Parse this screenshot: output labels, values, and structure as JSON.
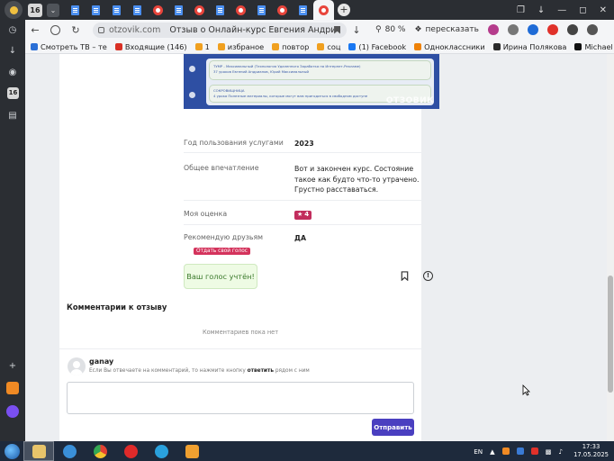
{
  "browser": {
    "tab_counter": "16",
    "tab_counter_side": "16",
    "address": {
      "domain": "otzovik.com",
      "title": "Отзыв о Онлайн-курс Евгения Андри..."
    },
    "zoom": "80 %",
    "speak_label": "пересказать"
  },
  "bookmarks": [
    {
      "label": "Смотреть ТВ – те",
      "color": "#2a6fd6"
    },
    {
      "label": "Входящие (146)",
      "color": "#d93025"
    },
    {
      "label": "1",
      "color": "#f0a020"
    },
    {
      "label": "избраное",
      "color": "#f0a020"
    },
    {
      "label": "повтор",
      "color": "#f0a020"
    },
    {
      "label": "соц",
      "color": "#f0a020"
    },
    {
      "label": "(1) Facebook",
      "color": "#1877f2"
    },
    {
      "label": "Одноклассники",
      "color": "#ee8208"
    },
    {
      "label": "Ирина Полякова",
      "color": "#2a2a2a"
    },
    {
      "label": "Michael Hudso",
      "color": "#111111"
    }
  ],
  "banner": {
    "row1_title": "ТУМР - Максимальный (Технология Удаленного Заработка на Интернет-Рекламе)",
    "row1_sub": "37 уроков  Евгений Андрианов, Юрий Максимальный",
    "row2_title": "СОКРОВИЩНИЦА",
    "row2_sub": "4 урока  Полезные материалы, которые могут вам пригодиться в свободном доступе",
    "watermark": "ОТЗОВИК"
  },
  "review": {
    "year_label": "Год пользования услугами",
    "year_value": "2023",
    "impression_label": "Общее впечатление",
    "impression_value": "Вот и закончен курс. Состояние такое как будто что-то утрачено. Грустно расставаться.",
    "rating_label": "Моя оценка",
    "rating_value": "4",
    "recommend_label": "Рекомендую друзьям",
    "recommend_value": "ДА",
    "tooltip": "Отдать свой голос",
    "vote_text": "Ваш голос учтён!"
  },
  "comments": {
    "title": "Комментарии к отзыву",
    "empty_text": "Комментариев пока нет",
    "username": "ganay",
    "hint_prefix": "Если Вы отвечаете на комментарий, то нажмите кнопку ",
    "hint_bold": "ответить",
    "hint_suffix": " рядом с ним",
    "send_label": "Отправить"
  },
  "taskbar": {
    "lang": "EN",
    "time": "17:33",
    "date": "17.05.2025"
  },
  "colors": {
    "accent": "#4a3fc0",
    "rating": "#c22d5d",
    "recommend": "#3aa14a",
    "banner": "#2e4fa3"
  }
}
